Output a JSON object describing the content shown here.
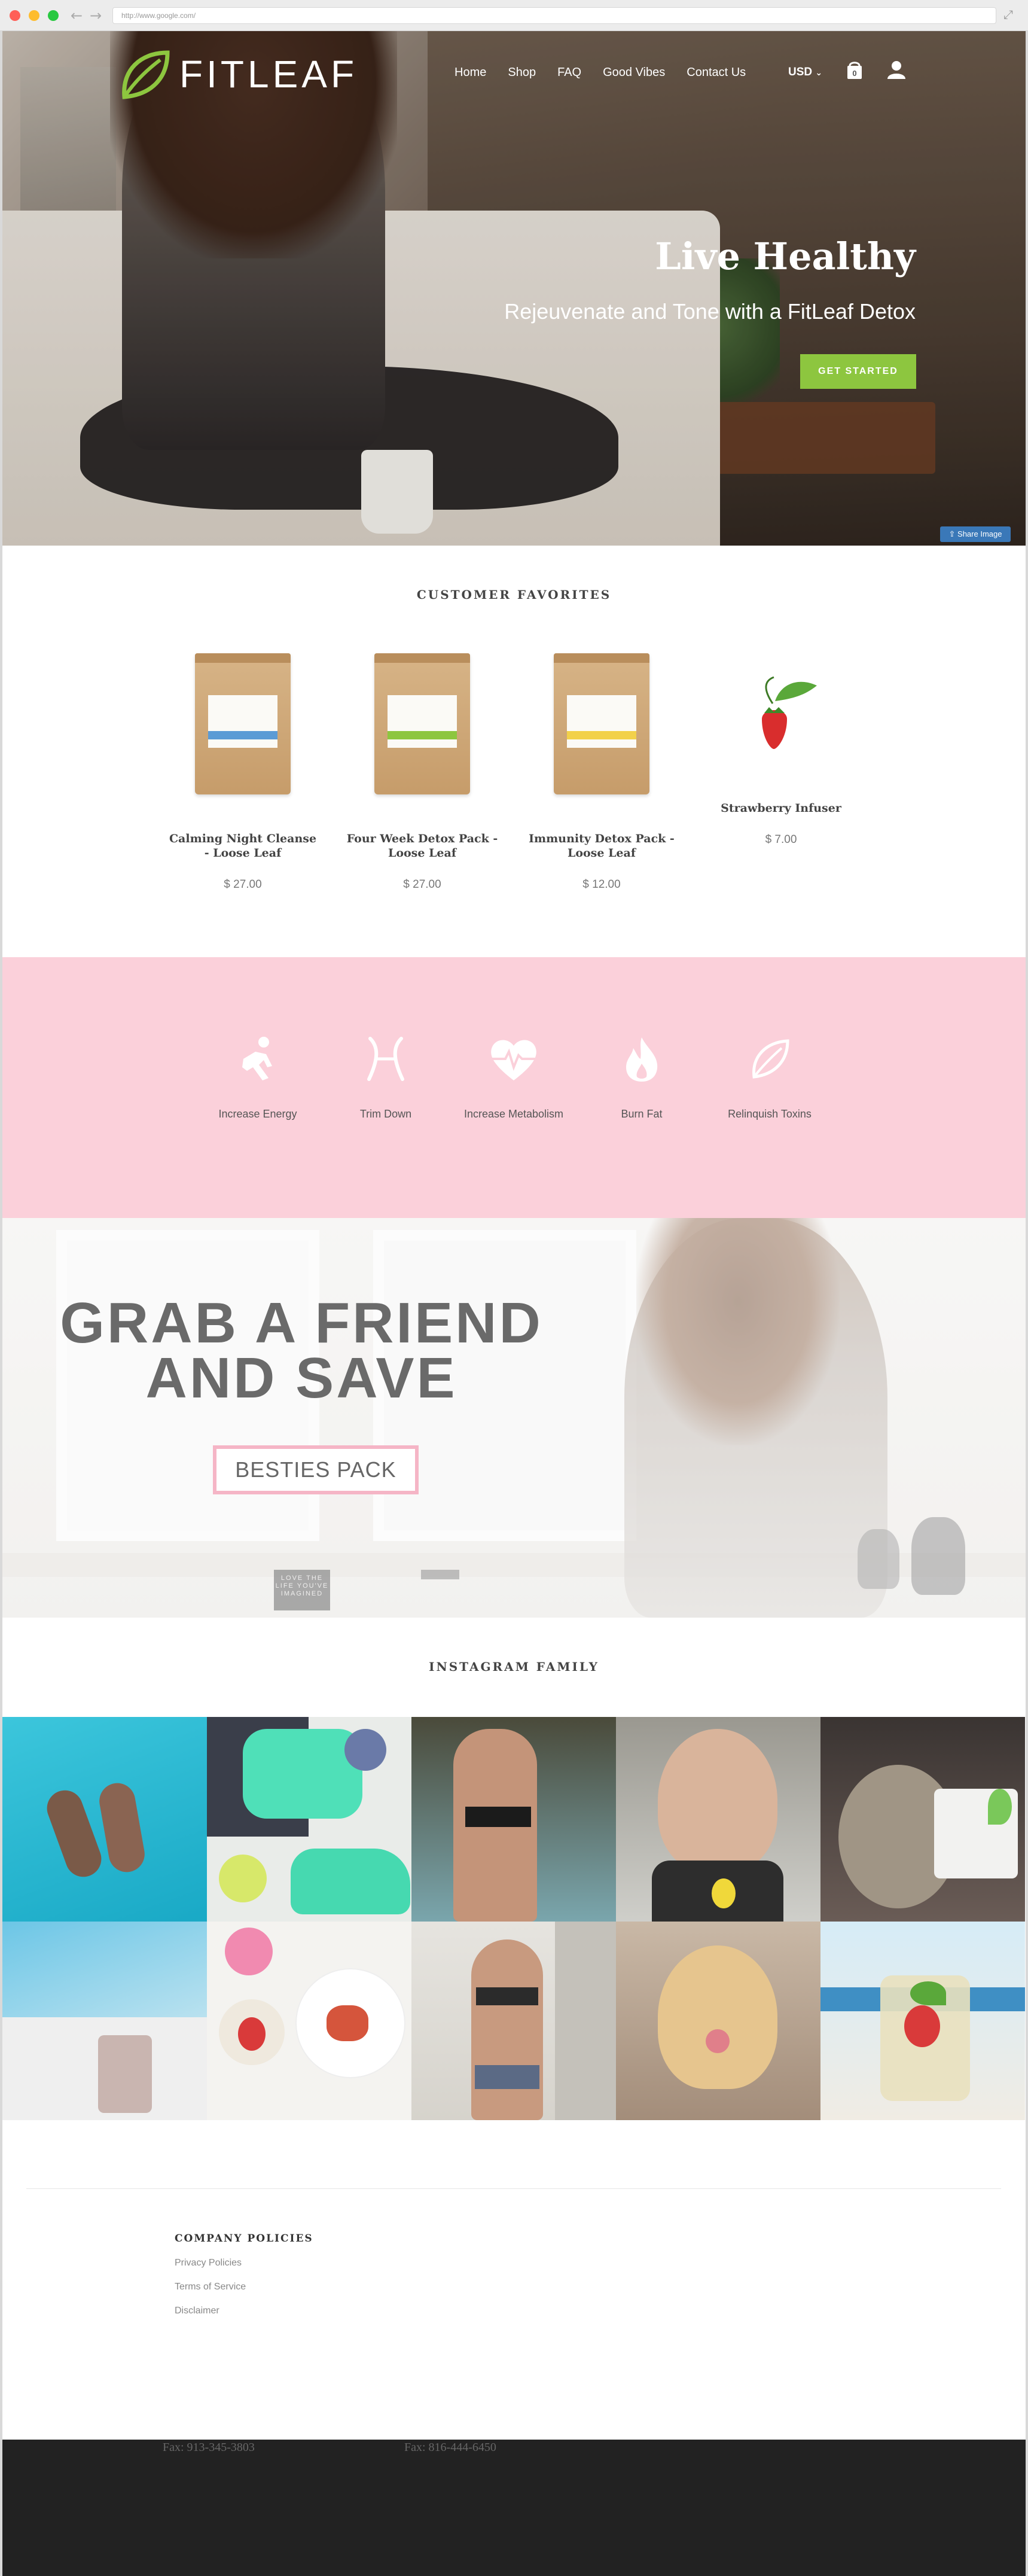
{
  "browser": {
    "url": "http://www.google.com/"
  },
  "header": {
    "brand": "FITLEAF",
    "nav": [
      "Home",
      "Shop",
      "FAQ",
      "Good Vibes",
      "Contact Us"
    ],
    "currency": "USD",
    "cart_icon": "bag-icon",
    "account_icon": "user-icon"
  },
  "hero": {
    "title": "Live Healthy",
    "subtitle": "Rejeuvenate and Tone with a FitLeaf Detox",
    "cta": "GET STARTED",
    "share_label": "Share Image"
  },
  "favorites": {
    "title": "CUSTOMER FAVORITES",
    "products": [
      {
        "name": "Calming Night Cleanse - Loose Leaf",
        "price": "$ 27.00",
        "band_color": "#5b9bd5"
      },
      {
        "name": "Four Week Detox Pack - Loose Leaf",
        "price": "$ 27.00",
        "band_color": "#8dc63f"
      },
      {
        "name": "Immunity Detox Pack - Loose Leaf",
        "price": "$ 12.00",
        "band_color": "#f2d14a"
      },
      {
        "name": "Strawberry Infuser",
        "price": "$ 7.00",
        "band_color": "#d92d2d"
      }
    ]
  },
  "benefits": [
    {
      "label": "Increase Energy",
      "icon": "runner-icon"
    },
    {
      "label": "Trim Down",
      "icon": "waist-icon"
    },
    {
      "label": "Increase Metabolism",
      "icon": "heartbeat-icon"
    },
    {
      "label": "Burn Fat",
      "icon": "flame-icon"
    },
    {
      "label": "Relinquish Toxins",
      "icon": "leaf-icon"
    }
  ],
  "promo": {
    "title_line1": "GRAB A FRIEND",
    "title_line2": "AND SAVE",
    "button": "BESTIES PACK",
    "book_text": "LOVE THE LIFE YOU'VE IMAGINED"
  },
  "instagram": {
    "title": "INSTAGRAM FAMILY"
  },
  "footer": {
    "policies_title": "COMPANY POLICIES",
    "links": [
      "Privacy Policies",
      "Terms of Service",
      "Disclaimer"
    ],
    "fax1": "Fax: 913-345-3803",
    "fax2": "Fax: 816-444-6450"
  },
  "colors": {
    "accent_green": "#8dc63f",
    "benefit_pink": "#fbd0da",
    "promo_border": "#f5b5c6",
    "footer_dark": "#222222"
  }
}
